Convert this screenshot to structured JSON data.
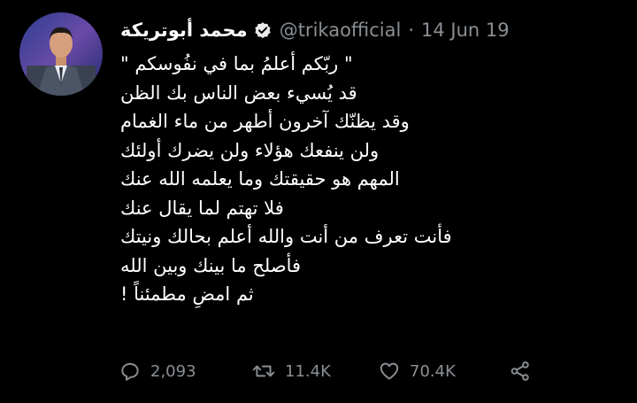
{
  "tweet": {
    "display_name": "محمد أبوتريكة",
    "handle": "@trikaofficial",
    "separator": "·",
    "date": "14 Jun 19",
    "lines": [
      "\" ربّكم أعلمُ بما في نفُوسكم \"",
      "قد يُسيء بعض الناس بك الظن",
      "وقد يظنّك آخرون أطهر من ماء الغمام",
      "ولن ينفعك هؤلاء ولن يضرك أولئك",
      "المهم هو حقيقتك وما يعلمه الله عنك",
      "فلا تهتم لما يقال عنك",
      "فأنت تعرف من أنت والله أعلم بحالك ونيتك",
      "فأصلح ما بينك وبين الله",
      "ثم امضِ مطمئناً !"
    ]
  },
  "actions": {
    "reply_count": "2,093",
    "retweet_count": "11.4K",
    "like_count": "70.4K"
  },
  "icons": {
    "verified": "verified-badge-icon",
    "reply": "reply-icon",
    "retweet": "retweet-icon",
    "like": "heart-icon",
    "share": "share-icon"
  },
  "colors": {
    "background": "#000000",
    "text": "#ffffff",
    "muted": "#8a8f94"
  }
}
